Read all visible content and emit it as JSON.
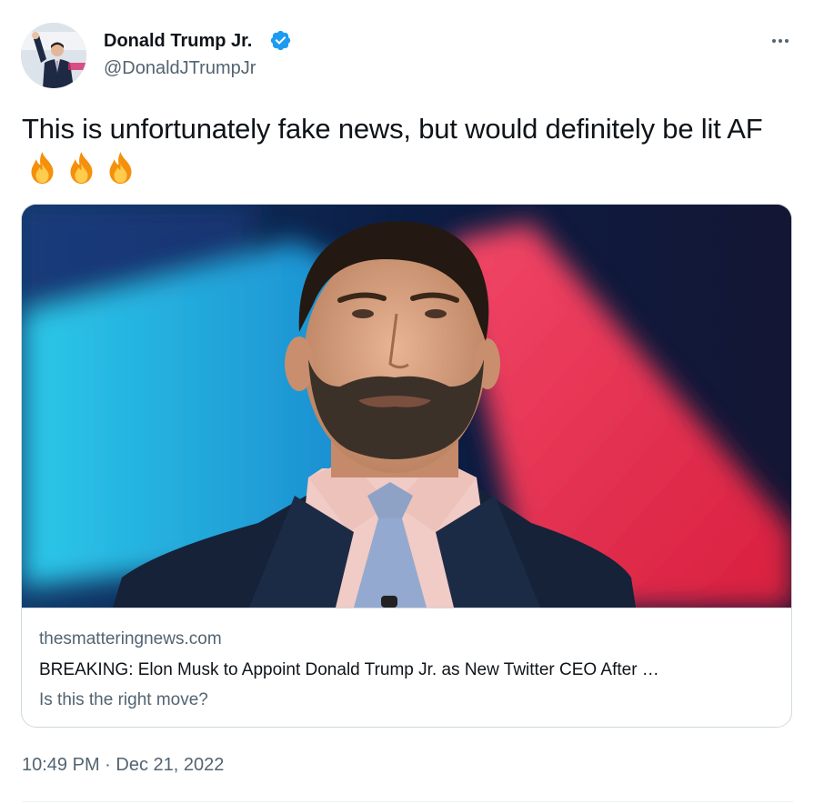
{
  "author": {
    "name": "Donald Trump Jr.",
    "handle": "@DonaldJTrumpJr",
    "verified": true,
    "avatar_icon": "profile-photo"
  },
  "tweet": {
    "text": "This is unfortunately fake news, but would definitely be lit AF",
    "emojis": [
      "fire-emoji",
      "fire-emoji",
      "fire-emoji"
    ]
  },
  "card": {
    "image_icon": "man-on-stage-photo",
    "domain": "thesmatteringnews.com",
    "title": "BREAKING: Elon Musk to Appoint Donald Trump Jr. as New Twitter CEO After …",
    "description": "Is this the right move?"
  },
  "timestamp": {
    "time": "10:49 PM",
    "separator": "·",
    "date": "Dec 21, 2022"
  },
  "colors": {
    "primary_text": "#0f1419",
    "secondary_text": "#536471",
    "border": "#cfd9de",
    "verified_badge": "#1d9bf0"
  }
}
